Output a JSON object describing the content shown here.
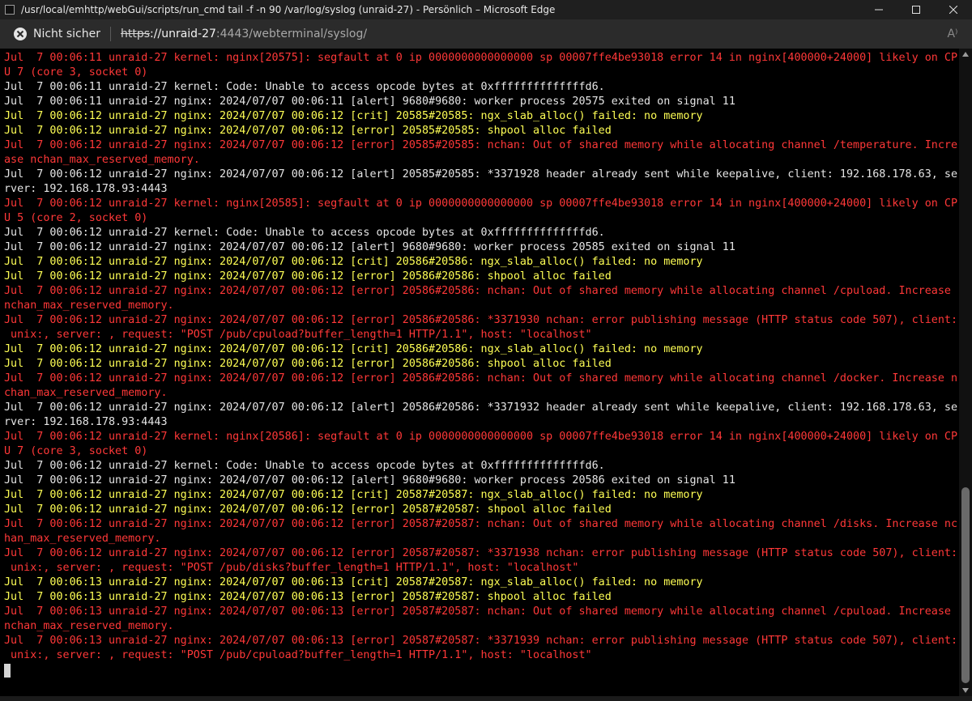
{
  "window": {
    "title": "/usr/local/emhttp/webGui/scripts/run_cmd tail -f -n 90 /var/log/syslog (unraid-27) - Persönlich – Microsoft Edge"
  },
  "addressbar": {
    "security_label": "Nicht sicher",
    "url_scheme": "https",
    "url_rest_host": "://unraid-27",
    "url_rest_path": ":4443/webterminal/syslog/",
    "read_aloud_glyph": "A⁾"
  },
  "colors": {
    "red": "#ff3838",
    "yellow": "#ffff55",
    "white": "#e5e5e5",
    "background": "#000000"
  },
  "terminal": {
    "lines": [
      {
        "text": "Jul  7 00:06:11 unraid-27 kernel: nginx[20575]: segfault at 0 ip 0000000000000000 sp 00007ffe4be93018 error 14 in nginx[400000+24000] likely on CP",
        "color": "red"
      },
      {
        "text": "U 7 (core 3, socket 0)",
        "color": "red"
      },
      {
        "text": "Jul  7 00:06:11 unraid-27 kernel: Code: Unable to access opcode bytes at 0xffffffffffffffd6.",
        "color": "white"
      },
      {
        "text": "Jul  7 00:06:11 unraid-27 nginx: 2024/07/07 00:06:11 [alert] 9680#9680: worker process 20575 exited on signal 11",
        "color": "white"
      },
      {
        "text": "Jul  7 00:06:12 unraid-27 nginx: 2024/07/07 00:06:12 [crit] 20585#20585: ngx_slab_alloc() failed: no memory",
        "color": "yellow"
      },
      {
        "text": "Jul  7 00:06:12 unraid-27 nginx: 2024/07/07 00:06:12 [error] 20585#20585: shpool alloc failed",
        "color": "yellow"
      },
      {
        "text": "Jul  7 00:06:12 unraid-27 nginx: 2024/07/07 00:06:12 [error] 20585#20585: nchan: Out of shared memory while allocating channel /temperature. Incre",
        "color": "red"
      },
      {
        "text": "ase nchan_max_reserved_memory.",
        "color": "red"
      },
      {
        "text": "Jul  7 00:06:12 unraid-27 nginx: 2024/07/07 00:06:12 [alert] 20585#20585: *3371928 header already sent while keepalive, client: 192.168.178.63, se",
        "color": "white"
      },
      {
        "text": "rver: 192.168.178.93:4443",
        "color": "white"
      },
      {
        "text": "Jul  7 00:06:12 unraid-27 kernel: nginx[20585]: segfault at 0 ip 0000000000000000 sp 00007ffe4be93018 error 14 in nginx[400000+24000] likely on CP",
        "color": "red"
      },
      {
        "text": "U 5 (core 2, socket 0)",
        "color": "red"
      },
      {
        "text": "Jul  7 00:06:12 unraid-27 kernel: Code: Unable to access opcode bytes at 0xffffffffffffffd6.",
        "color": "white"
      },
      {
        "text": "Jul  7 00:06:12 unraid-27 nginx: 2024/07/07 00:06:12 [alert] 9680#9680: worker process 20585 exited on signal 11",
        "color": "white"
      },
      {
        "text": "Jul  7 00:06:12 unraid-27 nginx: 2024/07/07 00:06:12 [crit] 20586#20586: ngx_slab_alloc() failed: no memory",
        "color": "yellow"
      },
      {
        "text": "Jul  7 00:06:12 unraid-27 nginx: 2024/07/07 00:06:12 [error] 20586#20586: shpool alloc failed",
        "color": "yellow"
      },
      {
        "text": "Jul  7 00:06:12 unraid-27 nginx: 2024/07/07 00:06:12 [error] 20586#20586: nchan: Out of shared memory while allocating channel /cpuload. Increase",
        "color": "red"
      },
      {
        "text": "nchan_max_reserved_memory.",
        "color": "red"
      },
      {
        "text": "Jul  7 00:06:12 unraid-27 nginx: 2024/07/07 00:06:12 [error] 20586#20586: *3371930 nchan: error publishing message (HTTP status code 507), client:",
        "color": "red"
      },
      {
        "text": " unix:, server: , request: \"POST /pub/cpuload?buffer_length=1 HTTP/1.1\", host: \"localhost\"",
        "color": "red"
      },
      {
        "text": "Jul  7 00:06:12 unraid-27 nginx: 2024/07/07 00:06:12 [crit] 20586#20586: ngx_slab_alloc() failed: no memory",
        "color": "yellow"
      },
      {
        "text": "Jul  7 00:06:12 unraid-27 nginx: 2024/07/07 00:06:12 [error] 20586#20586: shpool alloc failed",
        "color": "yellow"
      },
      {
        "text": "Jul  7 00:06:12 unraid-27 nginx: 2024/07/07 00:06:12 [error] 20586#20586: nchan: Out of shared memory while allocating channel /docker. Increase n",
        "color": "red"
      },
      {
        "text": "chan_max_reserved_memory.",
        "color": "red"
      },
      {
        "text": "Jul  7 00:06:12 unraid-27 nginx: 2024/07/07 00:06:12 [alert] 20586#20586: *3371932 header already sent while keepalive, client: 192.168.178.63, se",
        "color": "white"
      },
      {
        "text": "rver: 192.168.178.93:4443",
        "color": "white"
      },
      {
        "text": "Jul  7 00:06:12 unraid-27 kernel: nginx[20586]: segfault at 0 ip 0000000000000000 sp 00007ffe4be93018 error 14 in nginx[400000+24000] likely on CP",
        "color": "red"
      },
      {
        "text": "U 7 (core 3, socket 0)",
        "color": "red"
      },
      {
        "text": "Jul  7 00:06:12 unraid-27 kernel: Code: Unable to access opcode bytes at 0xffffffffffffffd6.",
        "color": "white"
      },
      {
        "text": "Jul  7 00:06:12 unraid-27 nginx: 2024/07/07 00:06:12 [alert] 9680#9680: worker process 20586 exited on signal 11",
        "color": "white"
      },
      {
        "text": "Jul  7 00:06:12 unraid-27 nginx: 2024/07/07 00:06:12 [crit] 20587#20587: ngx_slab_alloc() failed: no memory",
        "color": "yellow"
      },
      {
        "text": "Jul  7 00:06:12 unraid-27 nginx: 2024/07/07 00:06:12 [error] 20587#20587: shpool alloc failed",
        "color": "yellow"
      },
      {
        "text": "Jul  7 00:06:12 unraid-27 nginx: 2024/07/07 00:06:12 [error] 20587#20587: nchan: Out of shared memory while allocating channel /disks. Increase nc",
        "color": "red"
      },
      {
        "text": "han_max_reserved_memory.",
        "color": "red"
      },
      {
        "text": "Jul  7 00:06:12 unraid-27 nginx: 2024/07/07 00:06:12 [error] 20587#20587: *3371938 nchan: error publishing message (HTTP status code 507), client:",
        "color": "red"
      },
      {
        "text": " unix:, server: , request: \"POST /pub/disks?buffer_length=1 HTTP/1.1\", host: \"localhost\"",
        "color": "red"
      },
      {
        "text": "Jul  7 00:06:13 unraid-27 nginx: 2024/07/07 00:06:13 [crit] 20587#20587: ngx_slab_alloc() failed: no memory",
        "color": "yellow"
      },
      {
        "text": "Jul  7 00:06:13 unraid-27 nginx: 2024/07/07 00:06:13 [error] 20587#20587: shpool alloc failed",
        "color": "yellow"
      },
      {
        "text": "Jul  7 00:06:13 unraid-27 nginx: 2024/07/07 00:06:13 [error] 20587#20587: nchan: Out of shared memory while allocating channel /cpuload. Increase",
        "color": "red"
      },
      {
        "text": "nchan_max_reserved_memory.",
        "color": "red"
      },
      {
        "text": "Jul  7 00:06:13 unraid-27 nginx: 2024/07/07 00:06:13 [error] 20587#20587: *3371939 nchan: error publishing message (HTTP status code 507), client:",
        "color": "red"
      },
      {
        "text": " unix:, server: , request: \"POST /pub/cpuload?buffer_length=1 HTTP/1.1\", host: \"localhost\"",
        "color": "red"
      }
    ]
  }
}
